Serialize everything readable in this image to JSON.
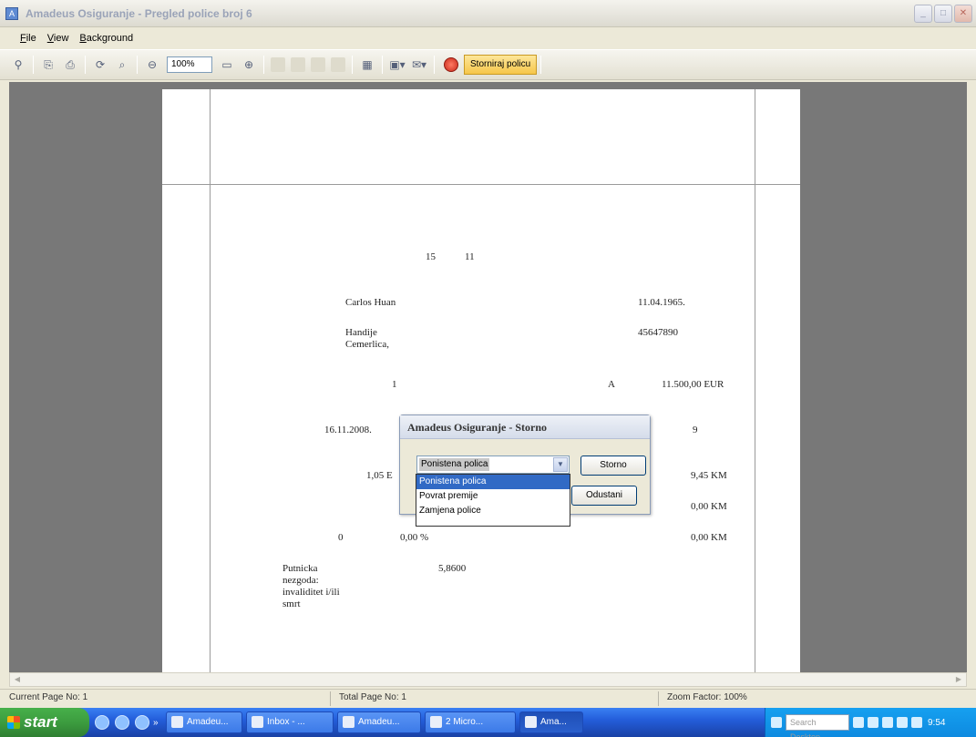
{
  "window": {
    "title": "Amadeus Osiguranje - Pregled police broj 6",
    "controls": [
      "_",
      "□",
      "✕"
    ]
  },
  "menu": [
    "File",
    "View",
    "Background"
  ],
  "toolbar": {
    "zoom_value": "100%",
    "storniraj_label": "Storniraj policu"
  },
  "page": {
    "fields": [
      {
        "id": "num-15",
        "text": "15"
      },
      {
        "id": "num-11",
        "text": "11"
      },
      {
        "id": "name",
        "text": "Carlos Huan"
      },
      {
        "id": "birth-date",
        "text": "11.04.1965."
      },
      {
        "id": "address",
        "text": "Handije Cemerlica,"
      },
      {
        "id": "id-number",
        "text": "45647890"
      },
      {
        "id": "count",
        "text": "1"
      },
      {
        "id": "class",
        "text": "A"
      },
      {
        "id": "amount-eur",
        "text": "11.500,00 EUR"
      },
      {
        "id": "date",
        "text": "16.11.2008."
      },
      {
        "id": "days",
        "text": "9"
      },
      {
        "id": "rate",
        "text": "1,05 E"
      },
      {
        "id": "premium-1",
        "text": "9,45 KM"
      },
      {
        "id": "premium-2",
        "text": "0,00 KM"
      },
      {
        "id": "zero",
        "text": "0"
      },
      {
        "id": "percent",
        "text": "0,00 %"
      },
      {
        "id": "premium-3",
        "text": "0,00 KM"
      },
      {
        "id": "risk",
        "text": "Putnicka nezgoda: invaliditet i/ili smrt"
      },
      {
        "id": "coef",
        "text": "5,8600"
      }
    ]
  },
  "dialog": {
    "title": "Amadeus Osiguranje - Storno",
    "combo_value": "Ponistena polica",
    "storno_label": "Storno",
    "cancel_label": "Odustani",
    "options": [
      "Ponistena polica",
      "Povrat premije",
      "Zamjena police"
    ],
    "selected_index": 0
  },
  "status": {
    "current_page": "Current Page No: 1",
    "total_page": "Total Page No: 1",
    "zoom": "Zoom Factor: 100%"
  },
  "taskbar": {
    "start": "start",
    "tasks": [
      "Amadeu...",
      "Inbox - ...",
      "Amadeu...",
      "2 Micro...",
      "Ama..."
    ],
    "active_task": 4,
    "search_placeholder": "Search Desktop",
    "clock": "9:54"
  }
}
